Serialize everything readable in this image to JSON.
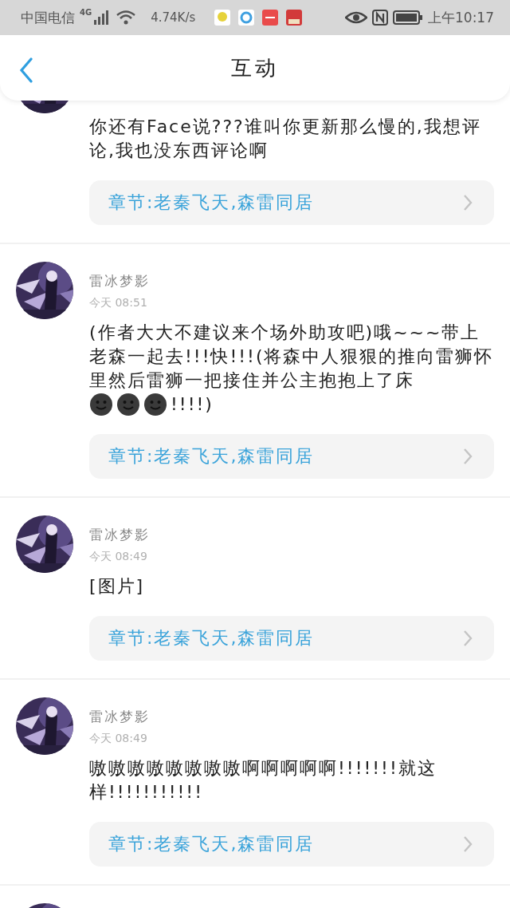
{
  "status_bar": {
    "carrier": "中国电信",
    "network": "4G",
    "speed": "4.74K/s",
    "time": "上午10:17"
  },
  "header": {
    "title": "互动"
  },
  "comments": [
    {
      "kind": "comment",
      "body": [
        {
          "kind": "text",
          "text": "你还有Face说???谁叫你更新那么慢的,我想评论,我也没东西评论啊"
        }
      ],
      "chapter": "章节:老秦飞天,森雷同居"
    },
    {
      "kind": "comment",
      "author": "雷冰梦影",
      "time": "今天 08:51",
      "body": [
        {
          "kind": "text",
          "text": "(作者大大不建议来个场外助攻吧)哦~~~带上老森一起去!!!快!!!(将森中人狠狠的推向雷狮怀里然后雷狮一把接住并公主抱抱上了床"
        },
        {
          "kind": "emoji"
        },
        {
          "kind": "emoji"
        },
        {
          "kind": "emoji"
        },
        {
          "kind": "text",
          "text": "!!!!)"
        }
      ],
      "chapter": "章节:老秦飞天,森雷同居"
    },
    {
      "kind": "comment",
      "author": "雷冰梦影",
      "time": "今天 08:49",
      "body": [
        {
          "kind": "text",
          "text": "[图片]"
        }
      ],
      "chapter": "章节:老秦飞天,森雷同居"
    },
    {
      "kind": "comment",
      "author": "雷冰梦影",
      "time": "今天 08:49",
      "body": [
        {
          "kind": "text",
          "text": "嗷嗷嗷嗷嗷嗷嗷嗷啊啊啊啊啊!!!!!!!就这样!!!!!!!!!!!"
        }
      ],
      "chapter": "章节:老秦飞天,森雷同居"
    },
    {
      "kind": "avatar_only"
    }
  ]
}
